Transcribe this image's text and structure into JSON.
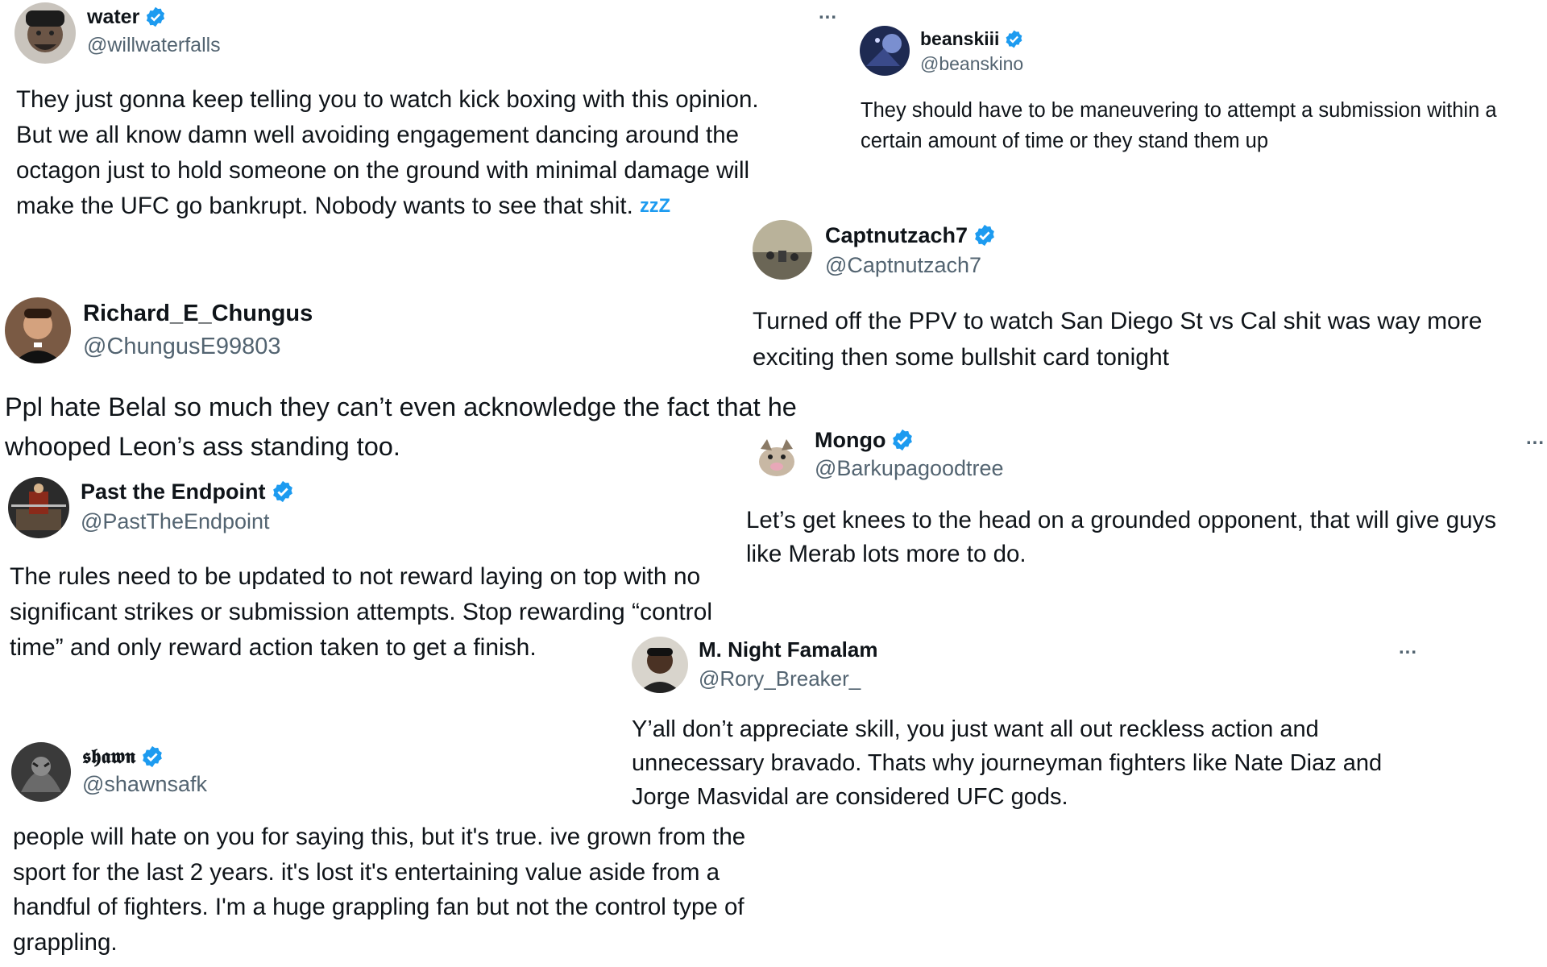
{
  "colors": {
    "verified": "#1d9bf0",
    "handle": "#536471",
    "text": "#0f1419"
  },
  "icons": {
    "verified": "verified-badge-icon",
    "more": "more-options-icon",
    "sleep": "zzz-emoji-icon"
  },
  "tweets": [
    {
      "name": "water",
      "handle": "@willwaterfalls",
      "verified": true,
      "more": "...",
      "text": "They just gonna keep telling you to watch kick boxing with this opinion.\nBut we all know damn well avoiding engagement dancing around the\noctagon just to hold someone on the ground with minimal damage will\nmake the UFC go bankrupt. Nobody wants to see that shit.",
      "emoji": "zzZ"
    },
    {
      "name": "beanskiii",
      "handle": "@beanskino",
      "verified": true,
      "text": "They should have to be maneuvering to attempt a submission within a\ncertain amount of time or they stand them up"
    },
    {
      "name": "Captnutzach7",
      "handle": "@Captnutzach7",
      "verified": true,
      "text": "Turned off the PPV to watch San Diego St vs Cal shit was way more\nexciting then some bullshit card tonight"
    },
    {
      "name": "Richard_E_Chungus",
      "handle": "@ChungusE99803",
      "verified": false,
      "text": "Ppl hate Belal so much they can’t even acknowledge the fact that he\nwhooped Leon’s ass standing too."
    },
    {
      "name": "Mongo",
      "handle": "@Barkupagoodtree",
      "verified": true,
      "more": "...",
      "text": "Let’s get knees to the head on a grounded opponent, that will give guys\nlike Merab lots more to do."
    },
    {
      "name": "Past the Endpoint",
      "handle": "@PastTheEndpoint",
      "verified": true,
      "text": "The rules need to be updated to not reward laying on top with no\nsignificant strikes or submission attempts.  Stop rewarding “control\ntime” and only reward action taken to get a finish."
    },
    {
      "name": "M. Night Famalam",
      "handle": "@Rory_Breaker_",
      "verified": false,
      "more": "...",
      "text": "Y’all don’t appreciate skill, you just want all out reckless action and\nunnecessary bravado. Thats why journeyman fighters like Nate Diaz and\nJorge Masvidal are considered UFC gods."
    },
    {
      "name": "𝖘𝖍𝖆𝖜𝖓",
      "handle": "@shawnsafk",
      "verified": true,
      "text": "people will hate on you for saying this, but it's true. ive grown from the\nsport for the last 2 years. it's lost it's entertaining value aside from a\nhandful of fighters. I'm a huge grappling fan but  not the control type of\ngrappling."
    }
  ]
}
